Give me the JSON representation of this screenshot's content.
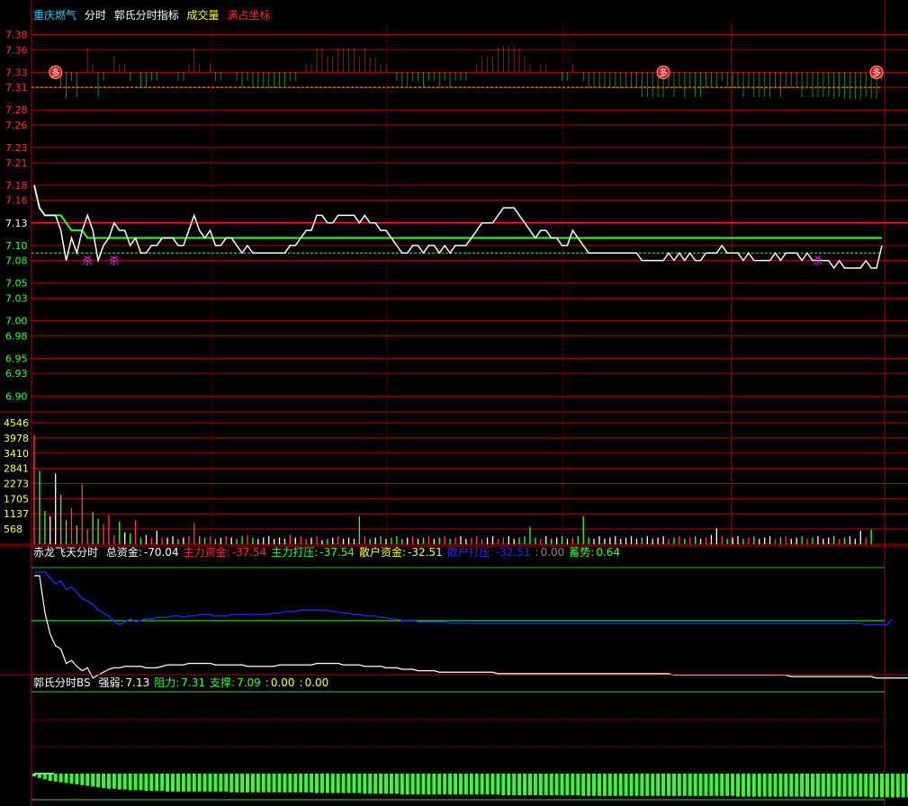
{
  "stock_name": "重庆燃气",
  "indicator_tags": [
    "分时",
    "郭氏分时指标",
    "成交量",
    "满占坐标"
  ],
  "panel2": {
    "name": "赤龙飞天分时",
    "items": [
      {
        "label": "总资金:",
        "value": "-70.04",
        "color": "#ffffff"
      },
      {
        "label": "主力资金:",
        "value": "-37.54",
        "color": "#ff3030"
      },
      {
        "label": "主力打压:",
        "value": "-37.54",
        "color": "#33ff33"
      },
      {
        "label": "散户资金:",
        "value": "-32.51",
        "color": "#ffff33"
      },
      {
        "label": "散户打压:",
        "value": "-32.51",
        "color": "#2a2aff"
      },
      {
        "label": ":",
        "value": "0.00",
        "color": "#888888"
      },
      {
        "label": "蓄势:",
        "value": "0.64",
        "color": "#33ff33"
      }
    ]
  },
  "panel3": {
    "name": "郭氏分时BS",
    "items": [
      {
        "label": "强弱:",
        "value": "7.13",
        "color": "#ffffff"
      },
      {
        "label": "阻力:",
        "value": "7.31",
        "color": "#33ff33"
      },
      {
        "label": "支撑:",
        "value": "7.09",
        "color": "#33ff33"
      },
      {
        "label": ":",
        "value": "0.00",
        "color": "#ffff33"
      },
      {
        "label": ":",
        "value": "0.00",
        "color": "#ffff33"
      }
    ]
  },
  "marker_labels": {
    "duo": "多",
    "sha": "杀"
  },
  "colors": {
    "grid": "#b00000",
    "price": "#ffffff",
    "avg": "#ffff33",
    "resist": "#ffaa00",
    "support": "#33ff33",
    "fund": "#2a2aff"
  },
  "chart_data": [
    {
      "type": "line",
      "panel": "price",
      "price_ticks": [
        "7.38",
        "7.36",
        "7.33",
        "7.31",
        "7.28",
        "7.26",
        "7.23",
        "7.21",
        "7.18",
        "7.16",
        "7.13",
        "7.10",
        "7.08",
        "7.05",
        "7.03",
        "7.00",
        "6.98",
        "6.95",
        "6.93",
        "6.90"
      ],
      "ylim": [
        6.88,
        7.395
      ],
      "prev_close": 7.13,
      "resistance": 7.31,
      "support": 7.09,
      "series": [
        {
          "values": [
            7.18,
            7.15,
            7.14,
            7.14,
            7.14,
            7.12,
            7.08,
            7.11,
            7.09,
            7.12,
            7.14,
            7.12,
            7.08,
            7.1,
            7.11,
            7.13,
            7.12,
            7.12,
            7.1,
            7.11,
            7.09,
            7.09,
            7.1,
            7.1,
            7.11,
            7.11,
            7.11,
            7.1,
            7.1,
            7.12,
            7.14,
            7.12,
            7.11,
            7.12,
            7.1,
            7.1,
            7.11,
            7.11,
            7.1,
            7.09,
            7.1,
            7.09,
            7.09,
            7.09,
            7.09,
            7.09,
            7.09,
            7.09,
            7.1,
            7.1,
            7.11,
            7.12,
            7.12,
            7.14,
            7.14,
            7.13,
            7.13,
            7.14,
            7.14,
            7.14,
            7.14,
            7.13,
            7.14,
            7.13,
            7.13,
            7.12,
            7.12,
            7.11,
            7.1,
            7.09,
            7.09,
            7.1,
            7.1,
            7.09,
            7.1,
            7.1,
            7.09,
            7.1,
            7.09,
            7.1,
            7.1,
            7.1,
            7.11,
            7.12,
            7.13,
            7.13,
            7.13,
            7.14,
            7.15,
            7.15,
            7.15,
            7.14,
            7.13,
            7.12,
            7.11,
            7.12,
            7.12,
            7.11,
            7.11,
            7.1,
            7.1,
            7.12,
            7.11,
            7.1,
            7.09,
            7.09,
            7.09,
            7.09,
            7.09,
            7.09,
            7.09,
            7.09,
            7.09,
            7.09,
            7.08,
            7.08,
            7.08,
            7.08,
            7.08,
            7.09,
            7.08,
            7.09,
            7.08,
            7.09,
            7.08,
            7.08,
            7.09,
            7.09,
            7.09,
            7.1,
            7.09,
            7.09,
            7.09,
            7.08,
            7.09,
            7.08,
            7.08,
            7.08,
            7.08,
            7.09,
            7.08,
            7.09,
            7.09,
            7.09,
            7.08,
            7.09,
            7.08,
            7.08,
            7.08,
            7.08,
            7.07,
            7.08,
            7.07,
            7.07,
            7.07,
            7.07,
            7.08,
            7.07,
            7.07,
            7.1
          ]
        },
        {
          "values": [
            7.18,
            7.15,
            7.14,
            7.14,
            7.14,
            7.14,
            7.13,
            7.12,
            7.12,
            7.12,
            7.11,
            7.11,
            7.11,
            7.11,
            7.11,
            7.11,
            7.11,
            7.11,
            7.11,
            7.11,
            7.11,
            7.11,
            7.11,
            7.11,
            7.11,
            7.11,
            7.11,
            7.11,
            7.11,
            7.11,
            7.11,
            7.11,
            7.11,
            7.11,
            7.11,
            7.11,
            7.11,
            7.11,
            7.11,
            7.11,
            7.11,
            7.11,
            7.11,
            7.11,
            7.11,
            7.11,
            7.11,
            7.11,
            7.11,
            7.11,
            7.11,
            7.11,
            7.11,
            7.11,
            7.11,
            7.11,
            7.11,
            7.11,
            7.11,
            7.11,
            7.11,
            7.11,
            7.11,
            7.11,
            7.11,
            7.11,
            7.11,
            7.11,
            7.11,
            7.11,
            7.11,
            7.11,
            7.11,
            7.11,
            7.11,
            7.11,
            7.11,
            7.11,
            7.11,
            7.11,
            7.11,
            7.11,
            7.11,
            7.11,
            7.11,
            7.11,
            7.11,
            7.11,
            7.11,
            7.11,
            7.11,
            7.11,
            7.11,
            7.11,
            7.11,
            7.11,
            7.11,
            7.11,
            7.11,
            7.11,
            7.11,
            7.11,
            7.11,
            7.11,
            7.11,
            7.11,
            7.11,
            7.11,
            7.11,
            7.11,
            7.11,
            7.11,
            7.11,
            7.11,
            7.11,
            7.11,
            7.11,
            7.11,
            7.11,
            7.11,
            7.11,
            7.11,
            7.11,
            7.11,
            7.11,
            7.11,
            7.11,
            7.11,
            7.11,
            7.11,
            7.11,
            7.11,
            7.11,
            7.11,
            7.11,
            7.11,
            7.11,
            7.11,
            7.11,
            7.11,
            7.11,
            7.11,
            7.11,
            7.11,
            7.11,
            7.11,
            7.11,
            7.11,
            7.11,
            7.11,
            7.11,
            7.11,
            7.11,
            7.11,
            7.11,
            7.11,
            7.11,
            7.11,
            7.11,
            7.11
          ]
        }
      ],
      "signals": [
        {
          "type": "duo",
          "index": 4,
          "price": 7.33
        },
        {
          "type": "duo",
          "index": 118,
          "price": 7.33
        },
        {
          "type": "duo",
          "index": 158,
          "price": 7.33
        },
        {
          "type": "sha",
          "index": 10,
          "price": 7.08
        },
        {
          "type": "sha",
          "index": 15,
          "price": 7.08
        },
        {
          "type": "sha",
          "index": 147,
          "price": 7.08
        }
      ]
    },
    {
      "type": "bar",
      "panel": "volume",
      "ticks": [
        "4546",
        "3978",
        "3410",
        "2841",
        "2273",
        "1705",
        "1137",
        "568"
      ],
      "ylim": [
        0,
        4850
      ],
      "values": [
        4100,
        2750,
        1250,
        1050,
        2650,
        1850,
        900,
        1350,
        700,
        2250,
        550,
        1200,
        950,
        750,
        1100,
        350,
        850,
        450,
        400,
        900,
        250,
        350,
        250,
        500,
        250,
        250,
        300,
        200,
        250,
        300,
        800,
        300,
        250,
        280,
        200,
        250,
        300,
        250,
        200,
        300,
        350,
        250,
        200,
        250,
        300,
        200,
        250,
        200,
        350,
        250,
        300,
        200,
        250,
        300,
        150,
        200,
        250,
        300,
        200,
        250,
        200,
        1050,
        300,
        200,
        250,
        300,
        200,
        250,
        300,
        200,
        250,
        300,
        200,
        250,
        300,
        200,
        250,
        300,
        200,
        250,
        300,
        200,
        250,
        300,
        200,
        250,
        300,
        200,
        250,
        300,
        200,
        250,
        300,
        650,
        250,
        200,
        300,
        200,
        250,
        300,
        200,
        250,
        300,
        1050,
        250,
        200,
        300,
        200,
        250,
        300,
        200,
        250,
        300,
        200,
        250,
        300,
        200,
        250,
        300,
        200,
        250,
        300,
        200,
        250,
        300,
        200,
        250,
        350,
        600,
        300,
        200,
        250,
        300,
        200,
        250,
        300,
        200,
        250,
        300,
        200,
        250,
        300,
        200,
        250,
        300,
        200,
        250,
        300,
        200,
        250,
        300,
        200,
        250,
        300,
        200,
        500,
        250,
        550
      ]
    },
    {
      "type": "line",
      "panel": "fund",
      "ylim": [
        -72,
        0
      ],
      "series": [
        {
          "values": [
            0,
            0,
            0,
            -4,
            -8,
            -6,
            -12,
            -10,
            -14,
            -18,
            -20,
            -22,
            -26,
            -28,
            -30,
            -34,
            -36,
            -34,
            -32,
            -34,
            -33,
            -32,
            -32,
            -31,
            -31,
            -31,
            -30,
            -30,
            -31,
            -30,
            -30,
            -29,
            -29,
            -29,
            -30,
            -30,
            -30,
            -29,
            -29,
            -29,
            -29,
            -29,
            -29,
            -29,
            -29,
            -28,
            -28,
            -27,
            -27,
            -27,
            -26,
            -26,
            -26,
            -26,
            -26,
            -26,
            -27,
            -27,
            -28,
            -28,
            -29,
            -29,
            -30,
            -30,
            -30,
            -31,
            -31,
            -32,
            -32,
            -33,
            -33,
            -33,
            -34,
            -34,
            -34,
            -34,
            -34,
            -34,
            -35,
            -35,
            -35,
            -35,
            -35,
            -35,
            -35,
            -35,
            -35,
            -35,
            -35,
            -35,
            -35,
            -35,
            -35,
            -35,
            -35,
            -35,
            -35,
            -35,
            -35,
            -35,
            -35,
            -35,
            -35,
            -35,
            -35,
            -35,
            -35,
            -35,
            -35,
            -35,
            -35,
            -35,
            -35,
            -35,
            -35,
            -35,
            -35,
            -35,
            -35,
            -35,
            -35,
            -35,
            -35,
            -35,
            -35,
            -35,
            -35,
            -35,
            -35,
            -35,
            -35,
            -35,
            -35,
            -35,
            -35,
            -35,
            -35,
            -35,
            -35,
            -35,
            -35,
            -35,
            -35,
            -35,
            -35,
            -35,
            -35,
            -35,
            -35,
            -35,
            -35,
            -35,
            -35,
            -35,
            -35,
            -35,
            -36,
            -36,
            -36,
            -36,
            -36,
            -32
          ]
        },
        {
          "values": [
            0,
            0,
            -25,
            -40,
            -48,
            -50,
            -60,
            -58,
            -62,
            -65,
            -63,
            -70,
            -68,
            -66,
            -64,
            -63,
            -63,
            -62,
            -62,
            -62,
            -62,
            -63,
            -63,
            -63,
            -62,
            -61,
            -61,
            -61,
            -61,
            -60,
            -60,
            -60,
            -60,
            -60,
            -61,
            -61,
            -61,
            -61,
            -61,
            -61,
            -62,
            -62,
            -62,
            -62,
            -62,
            -62,
            -61,
            -61,
            -61,
            -61,
            -61,
            -61,
            -61,
            -60,
            -60,
            -60,
            -60,
            -60,
            -61,
            -61,
            -61,
            -61,
            -62,
            -62,
            -62,
            -62,
            -63,
            -63,
            -63,
            -64,
            -64,
            -64,
            -65,
            -65,
            -65,
            -65,
            -66,
            -66,
            -66,
            -66,
            -66,
            -66,
            -66,
            -66,
            -66,
            -66,
            -66,
            -67,
            -67,
            -67,
            -67,
            -67,
            -67,
            -67,
            -67,
            -67,
            -67,
            -67,
            -67,
            -67,
            -67,
            -67,
            -67,
            -67,
            -67,
            -67,
            -67,
            -67,
            -67,
            -67,
            -67,
            -67,
            -67,
            -67,
            -67,
            -67,
            -67,
            -67,
            -67,
            -67,
            -68,
            -68,
            -68,
            -68,
            -68,
            -68,
            -68,
            -68,
            -68,
            -68,
            -68,
            -68,
            -68,
            -68,
            -68,
            -68,
            -68,
            -68,
            -68,
            -68,
            -68,
            -68,
            -69,
            -69,
            -69,
            -69,
            -69,
            -69,
            -69,
            -69,
            -69,
            -69,
            -69,
            -69,
            -69,
            -69,
            -69,
            -69,
            -70,
            -70,
            -70,
            -70,
            -70,
            -70,
            -70,
            -68
          ]
        }
      ]
    },
    {
      "type": "bar",
      "panel": "bs",
      "ylim": [
        -5,
        5
      ],
      "values": [
        -0.4,
        -0.6,
        -0.8,
        -1.0,
        -1.1,
        -1.2,
        -1.3,
        -1.4,
        -1.5,
        -1.6,
        -1.7,
        -1.8,
        -1.9,
        -2.0,
        -2.1,
        -2.1,
        -2.2,
        -2.2,
        -2.3,
        -2.3,
        -2.3,
        -2.4,
        -2.4,
        -2.4,
        -2.4,
        -2.5,
        -2.5,
        -2.5,
        -2.5,
        -2.5,
        -2.5,
        -2.5,
        -2.5,
        -2.5,
        -2.5,
        -2.5,
        -2.5,
        -2.6,
        -2.6,
        -2.6,
        -2.6,
        -2.6,
        -2.6,
        -2.6,
        -2.6,
        -2.6,
        -2.6,
        -2.6,
        -2.6,
        -2.6,
        -2.6,
        -2.6,
        -2.6,
        -2.7,
        -2.7,
        -2.7,
        -2.7,
        -2.7,
        -2.7,
        -2.7,
        -2.7,
        -2.7,
        -2.8,
        -2.8,
        -2.8,
        -2.8,
        -2.8,
        -2.8,
        -2.8,
        -2.9,
        -2.9,
        -2.9,
        -2.9,
        -2.9,
        -2.9,
        -2.9,
        -2.9,
        -2.9,
        -2.9,
        -2.9,
        -2.9,
        -2.9,
        -2.9,
        -2.9,
        -2.9,
        -2.9,
        -2.9,
        -2.9,
        -3.0,
        -3.0,
        -3.0,
        -3.0,
        -3.0,
        -3.0,
        -3.0,
        -3.0,
        -3.0,
        -3.0,
        -3.0,
        -3.0,
        -3.0,
        -3.0,
        -3.0,
        -3.1,
        -3.1,
        -3.1,
        -3.1,
        -3.1,
        -3.1,
        -3.1,
        -3.1,
        -3.1,
        -3.1,
        -3.1,
        -3.1,
        -3.1,
        -3.1,
        -3.1,
        -3.1,
        -3.1,
        -3.1,
        -3.1,
        -3.1,
        -3.1,
        -3.1,
        -3.1,
        -3.1,
        -3.1,
        -3.1,
        -3.1,
        -3.1,
        -3.1,
        -3.2,
        -3.2,
        -3.2,
        -3.2,
        -3.2,
        -3.2,
        -3.2,
        -3.2,
        -3.2,
        -3.2,
        -3.2,
        -3.2,
        -3.2,
        -3.2,
        -3.2,
        -3.2,
        -3.2,
        -3.2,
        -3.2,
        -3.2,
        -3.2,
        -3.2,
        -3.2,
        -3.2,
        -3.2,
        -3.3,
        -3.3,
        -3.3,
        -3.3,
        -3.3,
        -3.3,
        -3.3,
        -3.3,
        -3.3
      ]
    }
  ]
}
